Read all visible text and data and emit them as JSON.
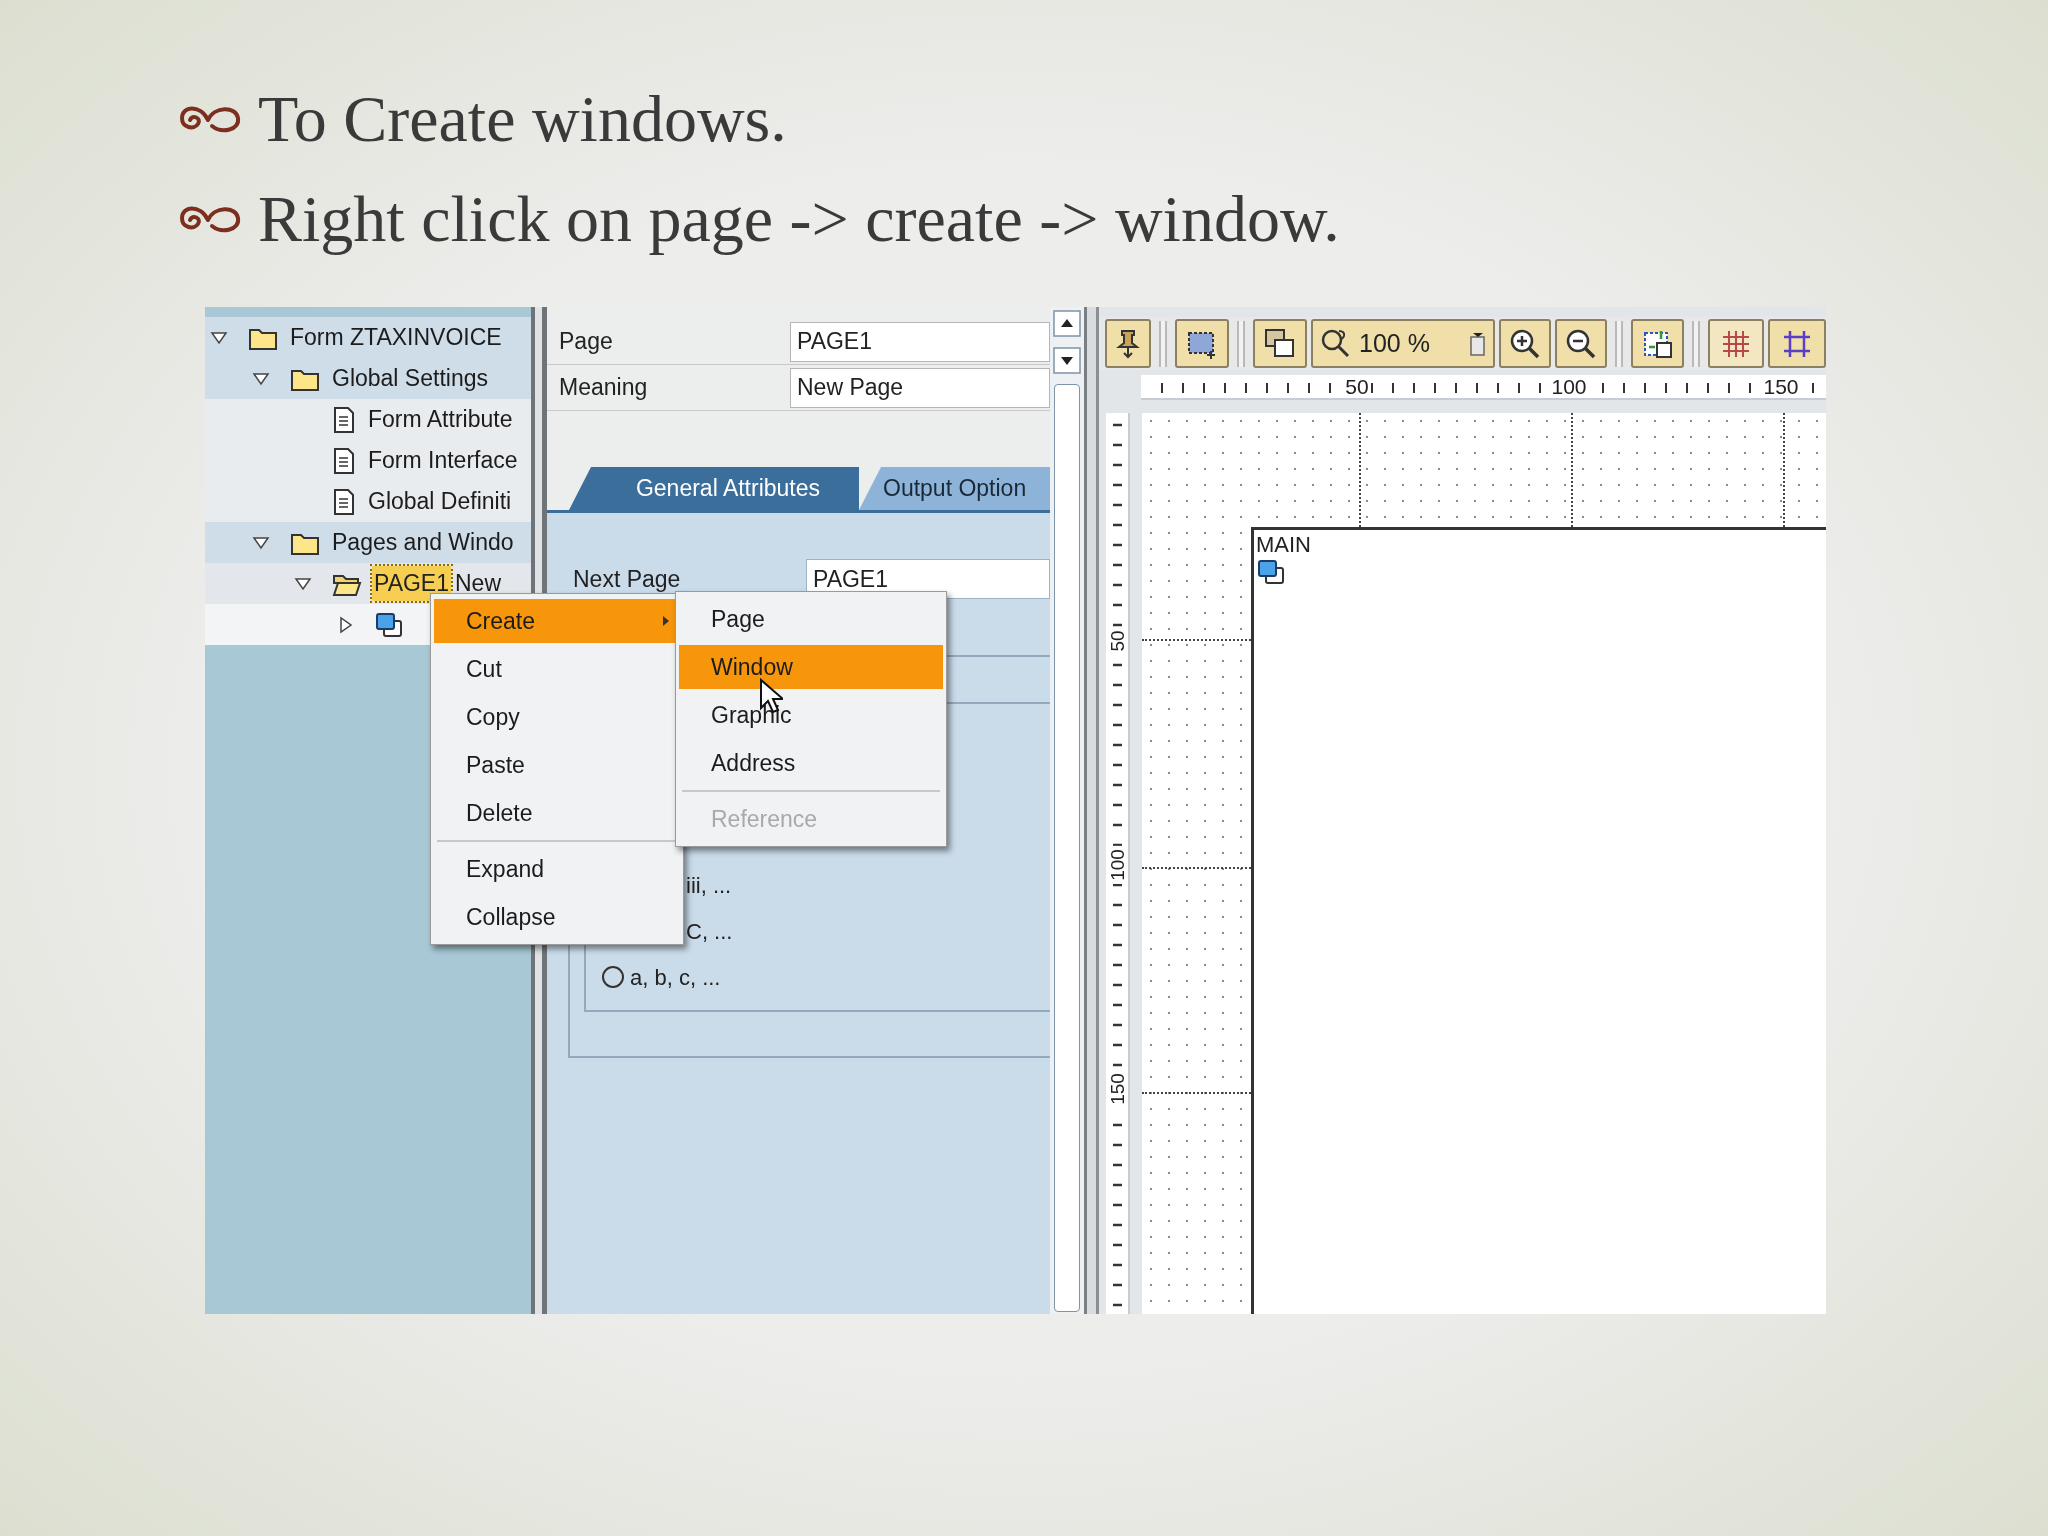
{
  "slide": {
    "bullets": [
      "To Create windows.",
      "Right click on page -> create -> window."
    ]
  },
  "tree": {
    "items": [
      {
        "label": "Form ZTAXINVOICE",
        "kind": "folder",
        "expanded": true,
        "selected": false,
        "children": [
          {
            "label": "Global Settings",
            "kind": "folder",
            "expanded": true,
            "selected": false,
            "children": [
              {
                "label": "Form Attribute",
                "kind": "document",
                "selected": false
              },
              {
                "label": "Form Interface",
                "kind": "document",
                "selected": false
              },
              {
                "label": "Global Definiti",
                "kind": "document",
                "selected": false
              }
            ]
          },
          {
            "label": "Pages and Windo",
            "kind": "folder",
            "expanded": true,
            "selected": false,
            "children": [
              {
                "label": "PAGE1",
                "description": "New",
                "kind": "page",
                "expanded": true,
                "selected": true,
                "children": [
                  {
                    "kind": "window",
                    "expanded": false,
                    "selected": false
                  }
                ]
              }
            ]
          }
        ]
      }
    ]
  },
  "properties": {
    "fields": [
      {
        "label": "Page",
        "value": "PAGE1"
      },
      {
        "label": "Meaning",
        "value": "New Page"
      }
    ],
    "tabs": [
      {
        "label": "General Attributes",
        "selected": true
      },
      {
        "label": "Output Option",
        "selected": false
      }
    ],
    "tab_fields": [
      {
        "label": "Next Page",
        "value": "PAGE1"
      }
    ],
    "numbering_options": [
      {
        "label": "iii, ...",
        "kind": "partial"
      },
      {
        "label": "C, ...",
        "kind": "partial"
      },
      {
        "label": "a, b, c, ...",
        "kind": "radio",
        "selected": false
      }
    ]
  },
  "layout_editor": {
    "zoom": "100 %",
    "x_ruler_labels": [
      "50",
      "100",
      "150"
    ],
    "y_ruler_labels": [
      "50",
      "100",
      "150"
    ],
    "windows": [
      {
        "label": "MAIN"
      }
    ]
  },
  "context_menu": {
    "items": [
      {
        "label": "Create",
        "kind": "submenu",
        "selected": true
      },
      {
        "label": "Cut",
        "kind": "item",
        "selected": false
      },
      {
        "label": "Copy",
        "kind": "item",
        "selected": false
      },
      {
        "label": "Paste",
        "kind": "item",
        "selected": false
      },
      {
        "label": "Delete",
        "kind": "item",
        "selected": false
      },
      {
        "kind": "separator"
      },
      {
        "label": "Expand",
        "kind": "item",
        "selected": false
      },
      {
        "label": "Collapse",
        "kind": "item",
        "selected": false
      }
    ]
  },
  "submenu": {
    "items": [
      {
        "label": "Page",
        "kind": "item",
        "selected": false,
        "disabled": false
      },
      {
        "label": "Window",
        "kind": "item",
        "selected": true,
        "disabled": false
      },
      {
        "label": "Graphic",
        "kind": "item",
        "selected": false,
        "disabled": false
      },
      {
        "label": "Address",
        "kind": "item",
        "selected": false,
        "disabled": false
      },
      {
        "kind": "separator"
      },
      {
        "label": "Reference",
        "kind": "item",
        "selected": false,
        "disabled": true
      }
    ]
  }
}
